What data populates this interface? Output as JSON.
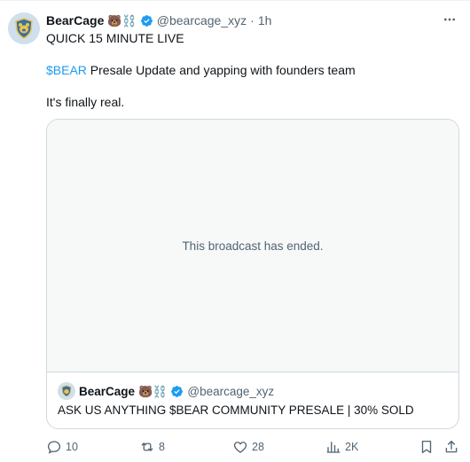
{
  "tweet": {
    "author_name": "BearCage",
    "author_emoji": "🐻⛓️",
    "handle": "@bearcage_xyz",
    "separator": "·",
    "time": "1h",
    "line1": "QUICK 15 MINUTE LIVE",
    "line2_cashtag": "$BEAR",
    "line2_rest": " Presale Update and yapping with founders team",
    "line3": "It's finally real."
  },
  "broadcast": {
    "status_text": "This broadcast has ended."
  },
  "quote": {
    "author_name": "BearCage",
    "author_emoji": "🐻⛓️",
    "handle": "@bearcage_xyz",
    "text": "ASK US ANYTHING $BEAR COMMUNITY PRESALE | 30% SOLD"
  },
  "actions": {
    "replies": "10",
    "reposts": "8",
    "likes": "28",
    "views": "2K"
  },
  "colors": {
    "accent": "#1d9bf0",
    "secondary_text": "#536471",
    "border": "#cfd9de",
    "placeholder_bg": "#f7f9f9"
  },
  "icons": {
    "verified": "verified-badge-icon",
    "more": "more-horizontal-icon",
    "reply": "reply-icon",
    "repost": "repost-icon",
    "like": "heart-icon",
    "views": "views-chart-icon",
    "bookmark": "bookmark-icon",
    "share": "share-icon"
  }
}
